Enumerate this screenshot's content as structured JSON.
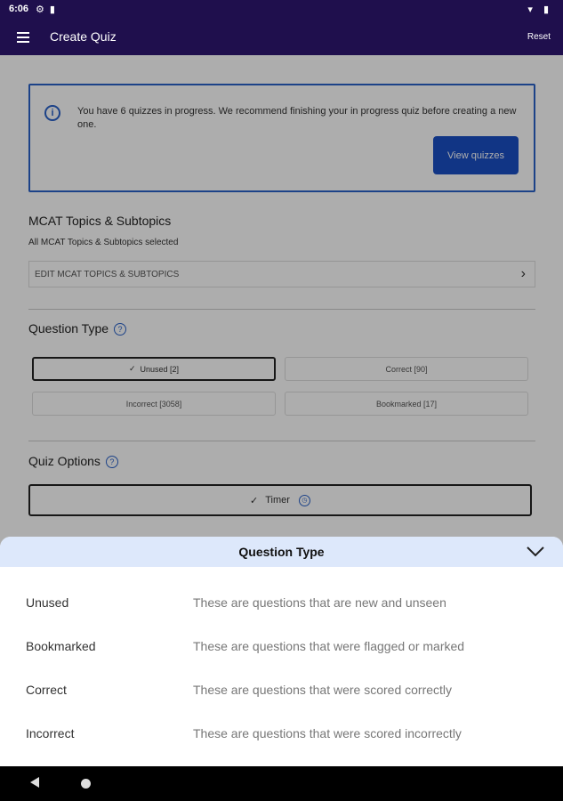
{
  "status": {
    "time": "6:06"
  },
  "app_bar": {
    "title": "Create Quiz",
    "reset": "Reset"
  },
  "banner": {
    "message": "You have 6 quizzes in progress. We recommend finishing your in progress quiz before creating a new one.",
    "button": "View quizzes"
  },
  "topics": {
    "title": "MCAT Topics & Subtopics",
    "subtitle": "All MCAT Topics & Subtopics selected",
    "edit_label": "EDIT MCAT TOPICS & SUBTOPICS"
  },
  "question_type": {
    "title": "Question Type",
    "options": [
      {
        "label": "Unused [2]",
        "selected": true
      },
      {
        "label": "Correct [90]",
        "selected": false
      },
      {
        "label": "Incorrect [3058]",
        "selected": false
      },
      {
        "label": "Bookmarked [17]",
        "selected": false
      }
    ]
  },
  "quiz_options": {
    "title": "Quiz Options",
    "timer": "Timer"
  },
  "sheet": {
    "title": "Question Type",
    "rows": [
      {
        "term": "Unused",
        "definition": "These are questions that are new and unseen"
      },
      {
        "term": "Bookmarked",
        "definition": "These are questions that were flagged or marked"
      },
      {
        "term": "Correct",
        "definition": "These are questions that were scored correctly"
      },
      {
        "term": "Incorrect",
        "definition": "These are questions that were scored incorrectly"
      }
    ]
  },
  "colors": {
    "app_bar": "#1f0f4d",
    "accent": "#1a4fc4",
    "sheet_header": "#dde8fb"
  }
}
